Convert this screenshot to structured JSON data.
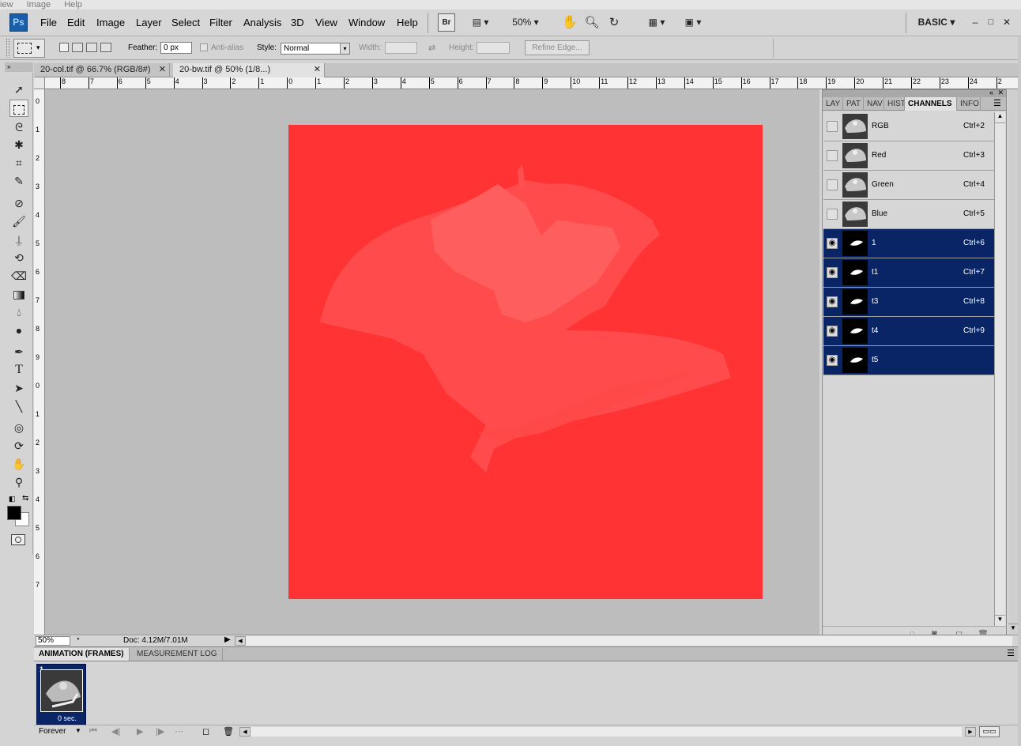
{
  "ghost_menu": [
    "iew",
    "Image",
    "Help"
  ],
  "app": {
    "logo": "Ps",
    "workspace": "BASIC"
  },
  "menus": [
    "File",
    "Edit",
    "Image",
    "Layer",
    "Select",
    "Filter",
    "Analysis",
    "3D",
    "View",
    "Window",
    "Help"
  ],
  "menubar": {
    "bridge": "Br",
    "zoom": "50%"
  },
  "options": {
    "feather_label": "Feather:",
    "feather_value": "0 px",
    "antialias_label": "Anti-alias",
    "style_label": "Style:",
    "style_value": "Normal",
    "width_label": "Width:",
    "height_label": "Height:",
    "refine_edge": "Refine Edge..."
  },
  "doc_tabs": [
    {
      "label": "20-col.tif @ 66.7% (RGB/8#)",
      "active": false
    },
    {
      "label": "20-bw.tif @ 50% (1/8...)",
      "active": true
    }
  ],
  "ruler_h": [
    "8",
    "7",
    "6",
    "5",
    "4",
    "3",
    "2",
    "1",
    "0",
    "1",
    "2",
    "3",
    "4",
    "5",
    "6",
    "7",
    "8",
    "9",
    "10",
    "11",
    "12",
    "13",
    "14",
    "15",
    "16",
    "17",
    "18",
    "19",
    "20",
    "21",
    "22",
    "23",
    "24",
    "2"
  ],
  "ruler_v": [
    "0",
    "1",
    "2",
    "3",
    "4",
    "5",
    "6",
    "7",
    "8",
    "9",
    "0",
    "1",
    "2",
    "3",
    "4",
    "5",
    "6",
    "7"
  ],
  "status": {
    "zoom": "50%",
    "doc": "Doc: 4.12M/7.01M"
  },
  "panel": {
    "tabs": [
      "LAY",
      "PAT",
      "NAV",
      "HIST",
      "CHANNELS",
      "INFO"
    ],
    "active_tab": "CHANNELS",
    "channels": [
      {
        "name": "RGB",
        "shortcut": "Ctrl+2",
        "visible": false,
        "selected": false
      },
      {
        "name": "Red",
        "shortcut": "Ctrl+3",
        "visible": false,
        "selected": false
      },
      {
        "name": "Green",
        "shortcut": "Ctrl+4",
        "visible": false,
        "selected": false
      },
      {
        "name": "Blue",
        "shortcut": "Ctrl+5",
        "visible": false,
        "selected": false
      },
      {
        "name": "1",
        "shortcut": "Ctrl+6",
        "visible": true,
        "selected": true
      },
      {
        "name": "t1",
        "shortcut": "Ctrl+7",
        "visible": true,
        "selected": true
      },
      {
        "name": "t3",
        "shortcut": "Ctrl+8",
        "visible": true,
        "selected": true
      },
      {
        "name": "t4",
        "shortcut": "Ctrl+9",
        "visible": true,
        "selected": true
      },
      {
        "name": "t5",
        "shortcut": "",
        "visible": true,
        "selected": true
      }
    ]
  },
  "animation": {
    "tabs": [
      "ANIMATION (FRAMES)",
      "MEASUREMENT LOG"
    ],
    "frame_number": "1",
    "frame_delay": "0 sec.",
    "loop": "Forever"
  },
  "colors": {
    "canvas_fill": "#ff3333",
    "selection": "#0a2566",
    "pasteboard": "#bdbdbd"
  }
}
